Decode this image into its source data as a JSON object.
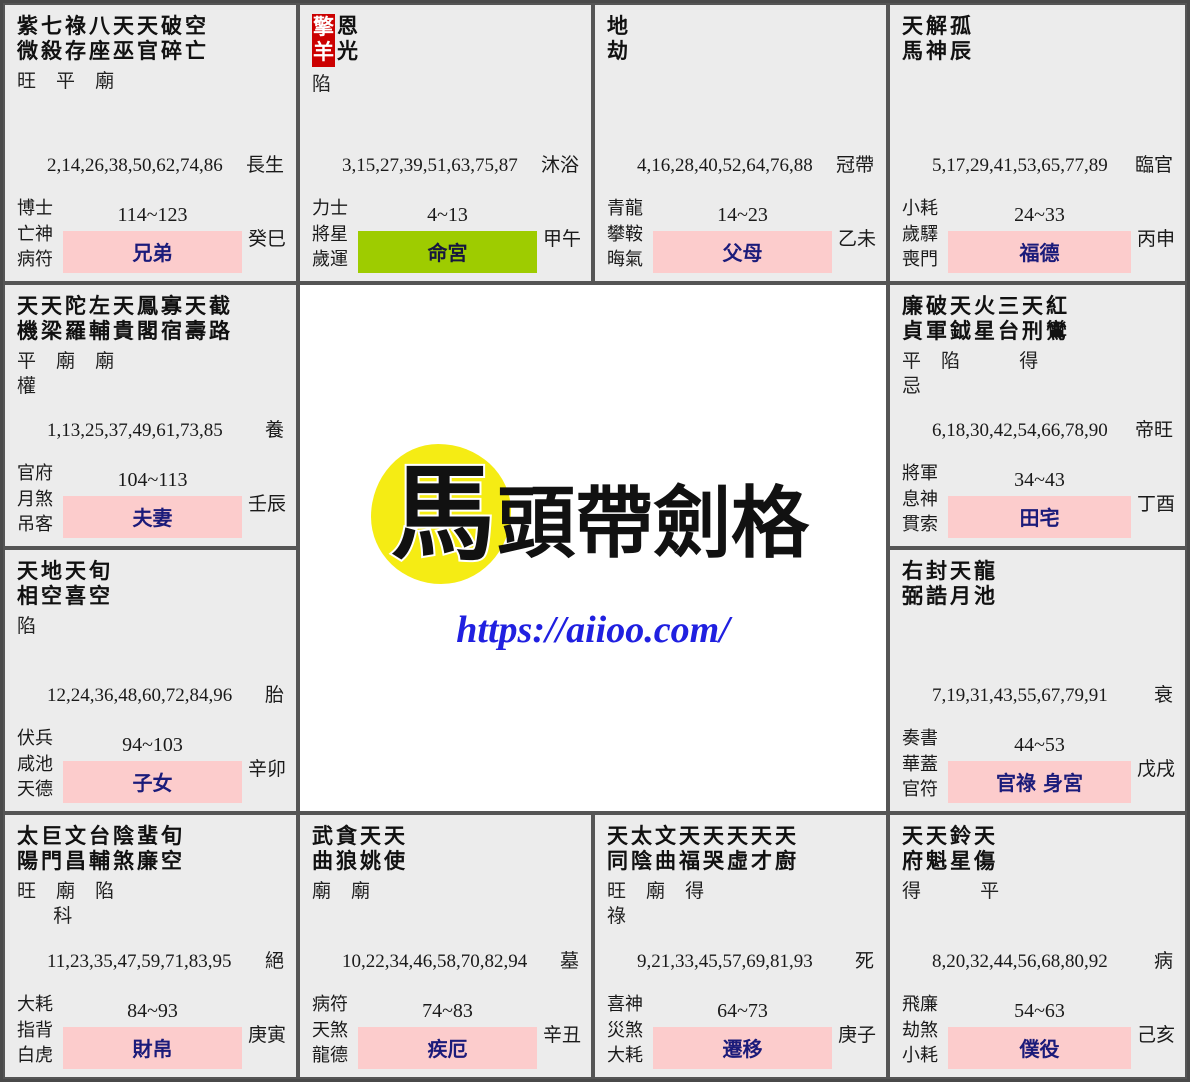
{
  "center": {
    "logo_first_char": "馬",
    "logo_rest": "頭帶劍格",
    "full_title": "馬頭帶劍格",
    "url": "https://aiioo.com/",
    "blob_color": "#f5ec14",
    "url_color": "#2020e0"
  },
  "theme": {
    "cell_bg": "#ececec",
    "center_bg": "#ffffff",
    "border": "#555555",
    "palace_badge_bg": "#fccccc",
    "palace_badge_text": "#1b1b7a",
    "ming_badge_bg": "#9ecc00",
    "star_highlight_bg": "#cc0000",
    "star_highlight_text": "#ffffff"
  },
  "palaces": [
    {
      "id": "palace-xiongdi",
      "stars": [
        {
          "text": "紫微",
          "highlight": false
        },
        {
          "text": "七殺",
          "highlight": false
        },
        {
          "text": "祿存",
          "highlight": false
        },
        {
          "text": "八座",
          "highlight": false
        },
        {
          "text": "天巫",
          "highlight": false
        },
        {
          "text": "天官",
          "highlight": false
        },
        {
          "text": "破碎",
          "highlight": false
        },
        {
          "text": "空亡",
          "highlight": false
        }
      ],
      "brightness": "旺 平 廟",
      "hua": "",
      "year_numbers": "2,14,26,38,50,62,74,86",
      "chang_sheng": "長生",
      "gods": [
        "博士",
        "亡神",
        "病符"
      ],
      "age_range": "114~123",
      "palace_name": "兄弟",
      "is_ming": false,
      "ganzhi": "癸巳"
    },
    {
      "id": "palace-mingong",
      "stars": [
        {
          "text": "擎羊",
          "highlight": true
        },
        {
          "text": "恩光",
          "highlight": false
        }
      ],
      "brightness": "陷",
      "hua": "",
      "year_numbers": "3,15,27,39,51,63,75,87",
      "chang_sheng": "沐浴",
      "gods": [
        "力士",
        "將星",
        "歲運"
      ],
      "age_range": "4~13",
      "palace_name": "命宮",
      "is_ming": true,
      "ganzhi": "甲午"
    },
    {
      "id": "palace-fumu",
      "stars": [
        {
          "text": "地劫",
          "highlight": false
        }
      ],
      "brightness": "",
      "hua": "",
      "year_numbers": "4,16,28,40,52,64,76,88",
      "chang_sheng": "冠帶",
      "gods": [
        "青龍",
        "攀鞍",
        "晦氣"
      ],
      "age_range": "14~23",
      "palace_name": "父母",
      "is_ming": false,
      "ganzhi": "乙未"
    },
    {
      "id": "palace-fude",
      "stars": [
        {
          "text": "天馬",
          "highlight": false
        },
        {
          "text": "解神",
          "highlight": false
        },
        {
          "text": "孤辰",
          "highlight": false
        }
      ],
      "brightness": "",
      "hua": "",
      "year_numbers": "5,17,29,41,53,65,77,89",
      "chang_sheng": "臨官",
      "gods": [
        "小耗",
        "歲驛",
        "喪門"
      ],
      "age_range": "24~33",
      "palace_name": "福德",
      "is_ming": false,
      "ganzhi": "丙申"
    },
    {
      "id": "palace-fuqi",
      "stars": [
        {
          "text": "天機",
          "highlight": false
        },
        {
          "text": "天梁",
          "highlight": false
        },
        {
          "text": "陀羅",
          "highlight": false
        },
        {
          "text": "左輔",
          "highlight": false
        },
        {
          "text": "天貴",
          "highlight": false
        },
        {
          "text": "鳳閣",
          "highlight": false
        },
        {
          "text": "寡宿",
          "highlight": false
        },
        {
          "text": "天壽",
          "highlight": false
        },
        {
          "text": "截路",
          "highlight": false
        }
      ],
      "brightness": "平 廟 廟",
      "hua": "權",
      "year_numbers": "1,13,25,37,49,61,73,85",
      "chang_sheng": "養",
      "gods": [
        "官府",
        "月煞",
        "吊客"
      ],
      "age_range": "104~113",
      "palace_name": "夫妻",
      "is_ming": false,
      "ganzhi": "壬辰"
    },
    {
      "id": "palace-tianzhai",
      "stars": [
        {
          "text": "廉貞",
          "highlight": false
        },
        {
          "text": "破軍",
          "highlight": false
        },
        {
          "text": "天鉞",
          "highlight": false
        },
        {
          "text": "火星",
          "highlight": false
        },
        {
          "text": "三台",
          "highlight": false
        },
        {
          "text": "天刑",
          "highlight": false
        },
        {
          "text": "紅鸞",
          "highlight": false
        }
      ],
      "brightness": "平 陷    得",
      "hua": "忌",
      "year_numbers": "6,18,30,42,54,66,78,90",
      "chang_sheng": "帝旺",
      "gods": [
        "將軍",
        "息神",
        "貫索"
      ],
      "age_range": "34~43",
      "palace_name": "田宅",
      "is_ming": false,
      "ganzhi": "丁酉"
    },
    {
      "id": "palace-zinv",
      "stars": [
        {
          "text": "天相",
          "highlight": false
        },
        {
          "text": "地空",
          "highlight": false
        },
        {
          "text": "天喜",
          "highlight": false
        },
        {
          "text": "旬空",
          "highlight": false
        }
      ],
      "brightness": "陷",
      "hua": "",
      "year_numbers": "12,24,36,48,60,72,84,96",
      "chang_sheng": "胎",
      "gods": [
        "伏兵",
        "咸池",
        "天德"
      ],
      "age_range": "94~103",
      "palace_name": "子女",
      "is_ming": false,
      "ganzhi": "辛卯"
    },
    {
      "id": "palace-guanlu",
      "stars": [
        {
          "text": "右弼",
          "highlight": false
        },
        {
          "text": "封誥",
          "highlight": false
        },
        {
          "text": "天月",
          "highlight": false
        },
        {
          "text": "龍池",
          "highlight": false
        }
      ],
      "brightness": "",
      "hua": "",
      "year_numbers": "7,19,31,43,55,67,79,91",
      "chang_sheng": "衰",
      "gods": [
        "奏書",
        "華蓋",
        "官符"
      ],
      "age_range": "44~53",
      "palace_name": "官祿 身宮",
      "is_ming": false,
      "ganzhi": "戊戌"
    },
    {
      "id": "palace-caibo",
      "stars": [
        {
          "text": "太陽",
          "highlight": false
        },
        {
          "text": "巨門",
          "highlight": false
        },
        {
          "text": "文昌",
          "highlight": false
        },
        {
          "text": "台輔",
          "highlight": false
        },
        {
          "text": "陰煞",
          "highlight": false
        },
        {
          "text": "蜚廉",
          "highlight": false
        },
        {
          "text": "旬空",
          "highlight": false
        }
      ],
      "brightness": "旺 廟 陷",
      "hua": "      科",
      "year_numbers": "11,23,35,47,59,71,83,95",
      "chang_sheng": "絕",
      "gods": [
        "大耗",
        "指背",
        "白虎"
      ],
      "age_range": "84~93",
      "palace_name": "財帛",
      "is_ming": false,
      "ganzhi": "庚寅"
    },
    {
      "id": "palace-jie",
      "stars": [
        {
          "text": "武曲",
          "highlight": false
        },
        {
          "text": "貪狼",
          "highlight": false
        },
        {
          "text": "天姚",
          "highlight": false
        },
        {
          "text": "天使",
          "highlight": false
        }
      ],
      "brightness": "廟 廟",
      "hua": "",
      "year_numbers": "10,22,34,46,58,70,82,94",
      "chang_sheng": "墓",
      "gods": [
        "病符",
        "天煞",
        "龍德"
      ],
      "age_range": "74~83",
      "palace_name": "疾厄",
      "is_ming": false,
      "ganzhi": "辛丑"
    },
    {
      "id": "palace-qianyi",
      "stars": [
        {
          "text": "天同",
          "highlight": false
        },
        {
          "text": "太陰",
          "highlight": false
        },
        {
          "text": "文曲",
          "highlight": false
        },
        {
          "text": "天福",
          "highlight": false
        },
        {
          "text": "天哭",
          "highlight": false
        },
        {
          "text": "天虛",
          "highlight": false
        },
        {
          "text": "天才",
          "highlight": false
        },
        {
          "text": "天廚",
          "highlight": false
        }
      ],
      "brightness": "旺 廟 得",
      "hua": "祿",
      "year_numbers": "9,21,33,45,57,69,81,93",
      "chang_sheng": "死",
      "gods": [
        "喜神",
        "災煞",
        "大耗"
      ],
      "age_range": "64~73",
      "palace_name": "遷移",
      "is_ming": false,
      "ganzhi": "庚子"
    },
    {
      "id": "palace-puyi",
      "stars": [
        {
          "text": "天府",
          "highlight": false
        },
        {
          "text": "天魁",
          "highlight": false
        },
        {
          "text": "鈴星",
          "highlight": false
        },
        {
          "text": "天傷",
          "highlight": false
        }
      ],
      "brightness": "得    平",
      "hua": "",
      "year_numbers": "8,20,32,44,56,68,80,92",
      "chang_sheng": "病",
      "gods": [
        "飛廉",
        "劫煞",
        "小耗"
      ],
      "age_range": "54~63",
      "palace_name": "僕役",
      "is_ming": false,
      "ganzhi": "己亥"
    }
  ]
}
